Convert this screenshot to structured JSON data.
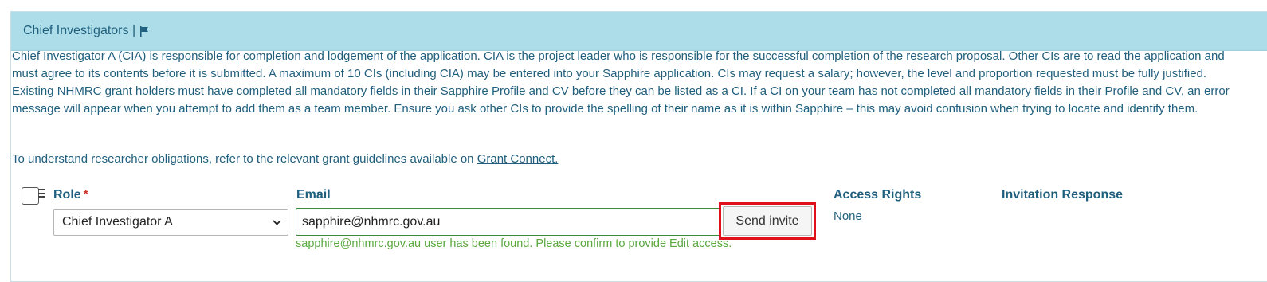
{
  "section": {
    "title": "Chief Investigators |",
    "flag_icon": "flag-icon"
  },
  "intro_text": "Chief Investigator A (CIA) is responsible for completion and lodgement of the application. CIA is the project leader who is responsible for the successful completion of the research proposal. Other CIs are to read the application and must agree to its contents before it is submitted. A maximum of 10 CIs (including CIA) may be entered into your Sapphire application. CIs may request a salary; however, the level and proportion requested must be fully justified. Existing NHMRC grant holders must have completed all mandatory fields in their Sapphire Profile and CV before they can be listed as a CI. If a CI on your team has not completed all mandatory fields in their Profile and CV, an error message will appear when you attempt to add them as a team member. Ensure you ask other CIs to provide the spelling of their name as it is within Sapphire – this may avoid confusion when trying to locate and identify them.",
  "obligations": {
    "text": "To understand researcher obligations, refer to the relevant grant guidelines available on ",
    "link_label": "Grant Connect."
  },
  "columns": {
    "role": "Role",
    "required_mark": "*",
    "email": "Email",
    "access_rights": "Access Rights",
    "invitation_response": "Invitation Response"
  },
  "row": {
    "role_selected": "Chief Investigator A",
    "email_value": "sapphire@nhmrc.gov.au",
    "send_invite_label": "Send invite",
    "status_message": "sapphire@nhmrc.gov.au user has been found. Please confirm to provide Edit access.",
    "access_rights_value": "None"
  },
  "colors": {
    "header_bg": "#acdde8",
    "text_primary": "#1f5f7d",
    "success": "#5aa83e",
    "highlight": "#e0101a"
  }
}
